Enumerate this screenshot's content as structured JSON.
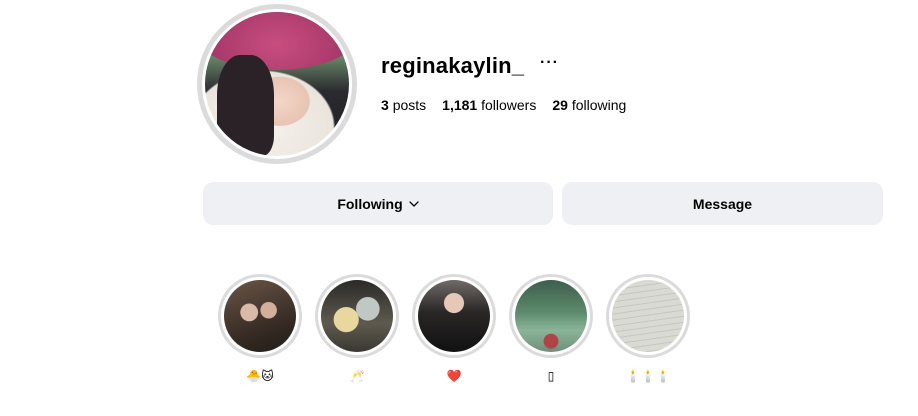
{
  "profile": {
    "username": "reginakaylin_",
    "more_icon": "ellipsis-icon",
    "stats": {
      "posts_count": "3",
      "posts_label": "posts",
      "followers_count": "1,181",
      "followers_label": "followers",
      "following_count": "29",
      "following_label": "following"
    }
  },
  "actions": {
    "following_label": "Following",
    "following_icon": "chevron-down-icon",
    "message_label": "Message"
  },
  "highlights": [
    {
      "label": "🐣🐱"
    },
    {
      "label": "🥂"
    },
    {
      "label": "❤️"
    },
    {
      "label": "▯"
    },
    {
      "label": "🕯️🕯️🕯️"
    }
  ],
  "colors": {
    "button_bg": "#eff0f4",
    "ring": "#dbdbdb",
    "text": "#000000"
  }
}
